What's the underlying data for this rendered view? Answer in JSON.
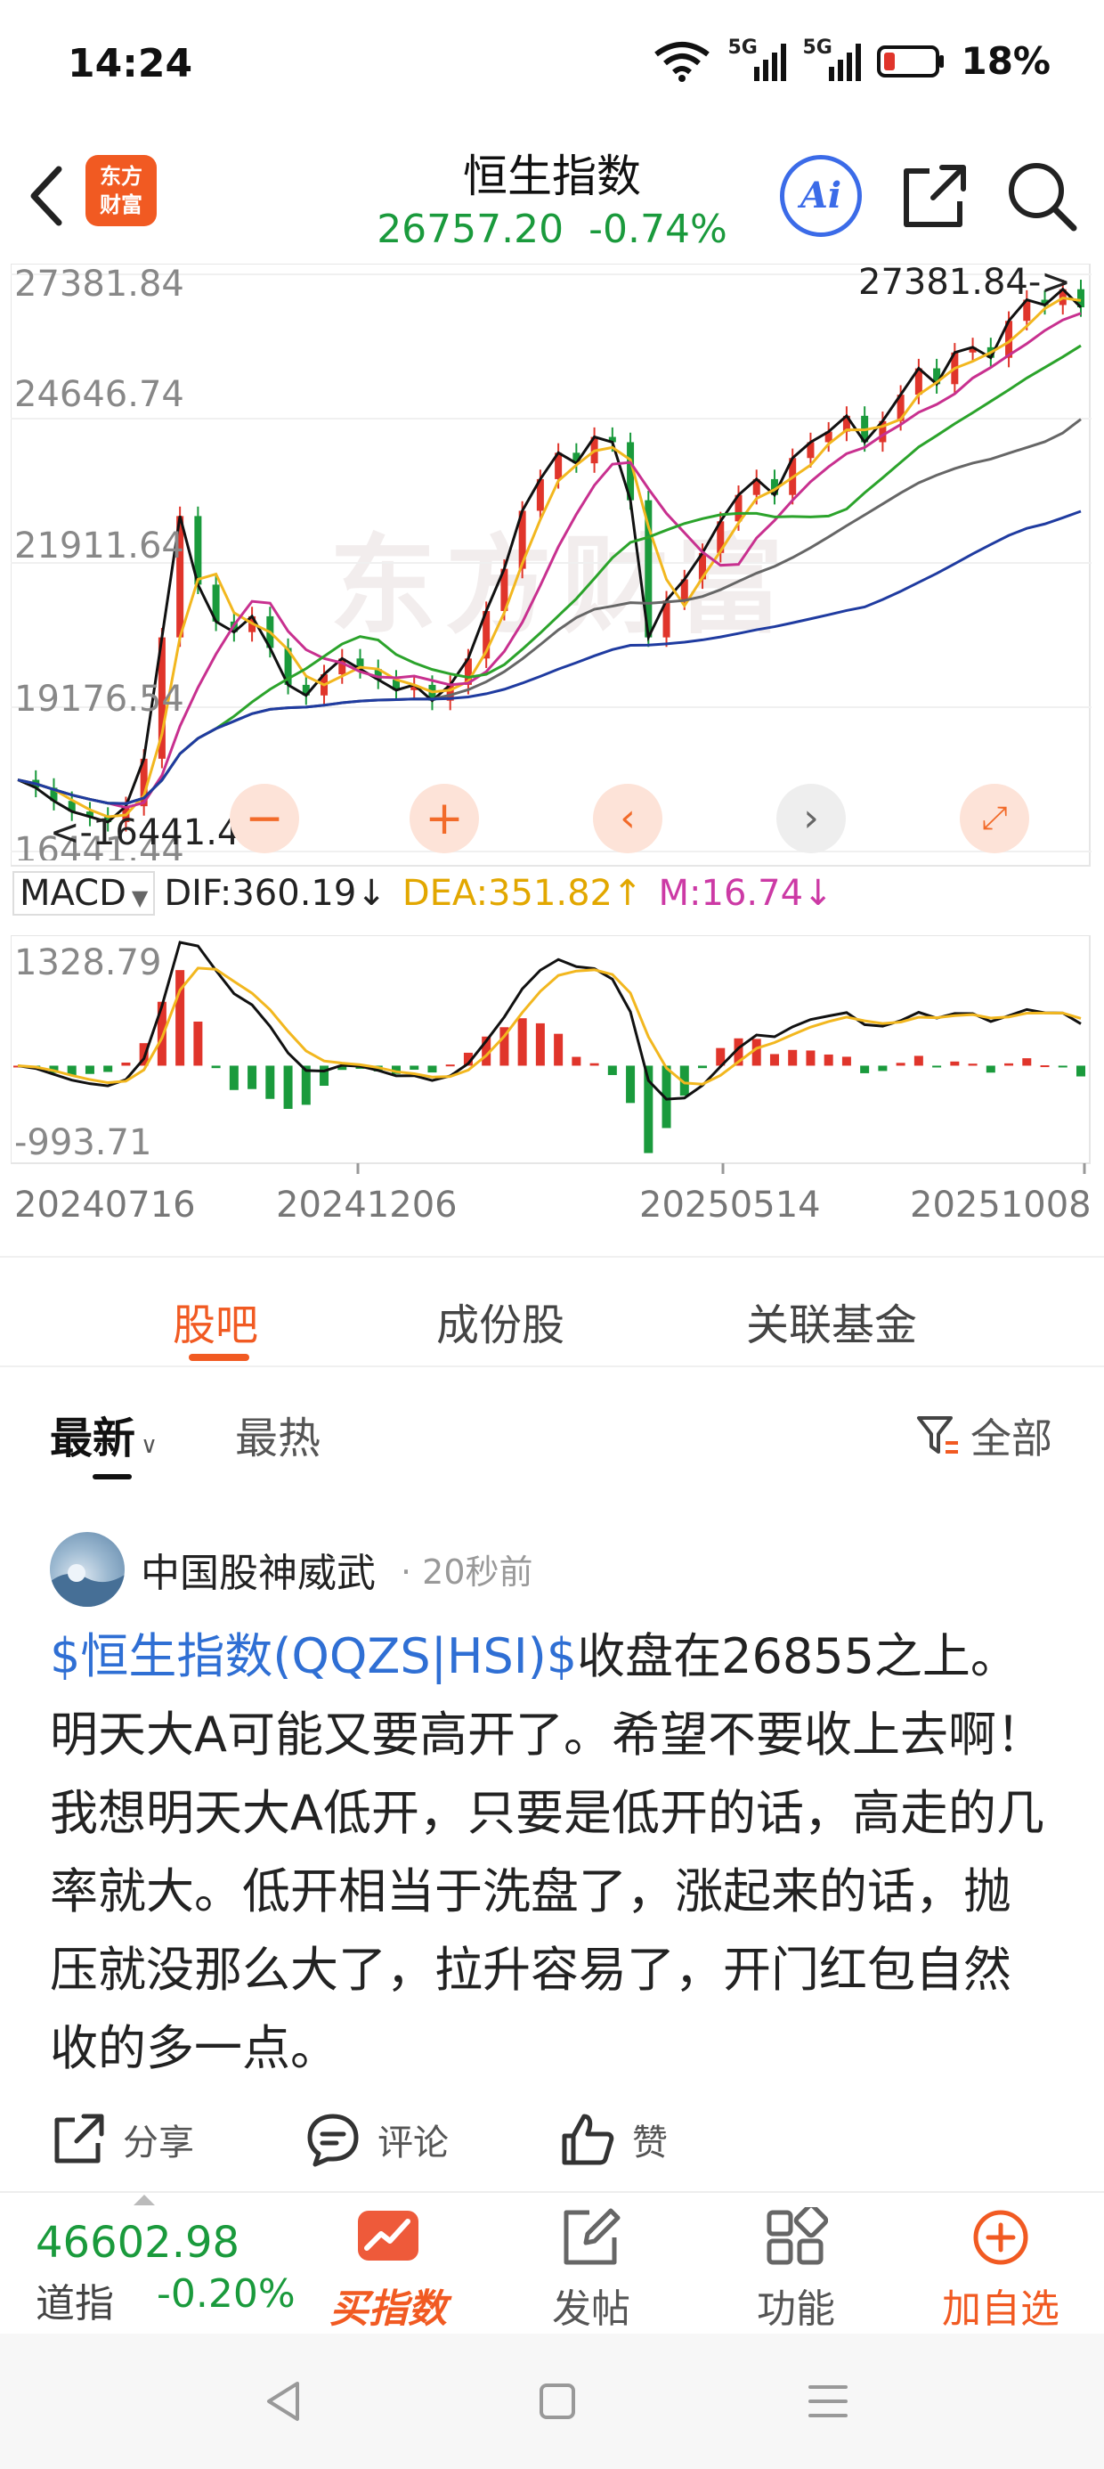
{
  "status_bar": {
    "time": "14:24",
    "signal_1": "5G",
    "signal_2": "5G",
    "battery": "18%"
  },
  "header": {
    "logo_line1": "东方",
    "logo_line2": "财富",
    "title": "恒生指数",
    "price": "26757.20",
    "change_pct": "-0.74%",
    "ai_label": "Ai"
  },
  "chart_data": {
    "type": "line",
    "price_axis_labels": [
      "27381.84",
      "24646.74",
      "21911.64",
      "19176.54",
      "16441.44"
    ],
    "max_marker": "27381.84->",
    "min_marker": "<-16441.44",
    "watermark": "东方财富",
    "date_labels": [
      "20240716",
      "20241206",
      "20250514",
      "20251008"
    ],
    "macd": {
      "indicator": "MACD",
      "dif": "DIF:360.19↓",
      "dea": "DEA:351.82↑",
      "m": "M:16.74↓",
      "upper": "1328.79",
      "lower": "-993.71"
    },
    "close_series": [
      17800,
      17650,
      17400,
      17200,
      17100,
      17000,
      17300,
      18200,
      20500,
      22800,
      21500,
      20800,
      20600,
      20900,
      20300,
      19600,
      19400,
      19800,
      20100,
      19900,
      19700,
      19500,
      19600,
      19300,
      19600,
      20100,
      21000,
      21800,
      22900,
      23500,
      24000,
      23800,
      24300,
      24200,
      23100,
      20500,
      21200,
      21600,
      22100,
      22700,
      23200,
      23500,
      23200,
      23900,
      24200,
      24400,
      24700,
      24200,
      24600,
      25100,
      25600,
      25300,
      25900,
      26000,
      25800,
      26500,
      26900,
      26800,
      27100,
      26757
    ]
  },
  "tabs": [
    "股吧",
    "成份股",
    "关联基金"
  ],
  "sort": {
    "latest": "最新",
    "hot": "最热",
    "filter": "全部"
  },
  "post": {
    "author": "中国股神威武",
    "time": "· 20秒前",
    "link": "$恒生指数(QQZS|HSI)$",
    "text": "收盘在26855之上。明天大A可能又要高开了。希望不要收上去啊！我想明天大A低开，只要是低开的话，高走的几率就大。低开相当于洗盘了，涨起来的话，抛压就没那么大了，拉升容易了，开门红包自然收的多一点。",
    "share": "分享",
    "comment": "评论",
    "like": "赞"
  },
  "bottom_bar": {
    "index_value": "46602.98",
    "index_name": "道指",
    "index_change": "-0.20%",
    "buy_index": "买指数",
    "post": "发帖",
    "functions": "功能",
    "add_watch": "加自选"
  },
  "colors": {
    "accent": "#f15a22",
    "down_green": "#1a9a3c",
    "up_red": "#e0352b",
    "link_blue": "#2f6fd4"
  }
}
